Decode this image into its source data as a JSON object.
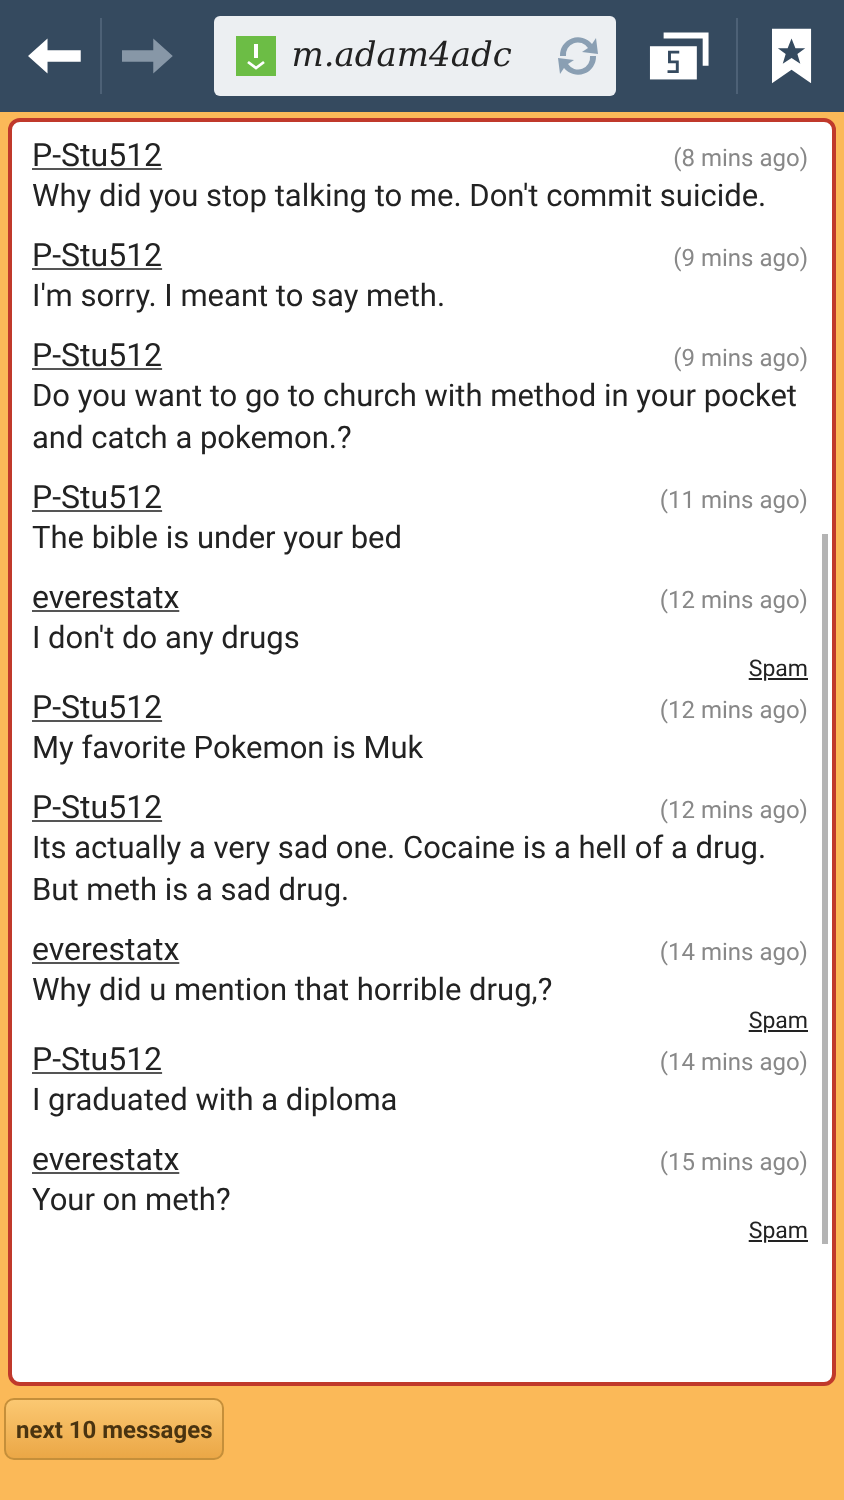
{
  "browser": {
    "url": "m.adam4adc"
  },
  "messages": [
    {
      "user": "P-Stu512",
      "time": "(8 mins ago)",
      "text": "Why did you stop talking to me. Don't commit suicide."
    },
    {
      "user": "P-Stu512",
      "time": "(9 mins ago)",
      "text": "I'm sorry. I meant to say meth."
    },
    {
      "user": "P-Stu512",
      "time": "(9 mins ago)",
      "text": "Do you want to go to church with method in your pocket and catch a pokemon.?"
    },
    {
      "user": "P-Stu512",
      "time": "(11 mins ago)",
      "text": "The bible is under your bed"
    },
    {
      "user": "everestatx",
      "time": "(12 mins ago)",
      "text": "I don't do any drugs",
      "spam": "Spam"
    },
    {
      "user": "P-Stu512",
      "time": "(12 mins ago)",
      "text": "My favorite Pokemon is Muk"
    },
    {
      "user": "P-Stu512",
      "time": "(12 mins ago)",
      "text": "Its actually a very sad one. Cocaine is a hell of a drug.\nBut meth is a sad drug."
    },
    {
      "user": "everestatx",
      "time": "(14 mins ago)",
      "text": "Why did u mention that horrible drug,?",
      "spam": "Spam"
    },
    {
      "user": "P-Stu512",
      "time": "(14 mins ago)",
      "text": "I graduated with a diploma"
    },
    {
      "user": "everestatx",
      "time": "(15 mins ago)",
      "text": "Your on meth?",
      "spam": "Spam"
    }
  ],
  "next_button": "next 10 messages"
}
